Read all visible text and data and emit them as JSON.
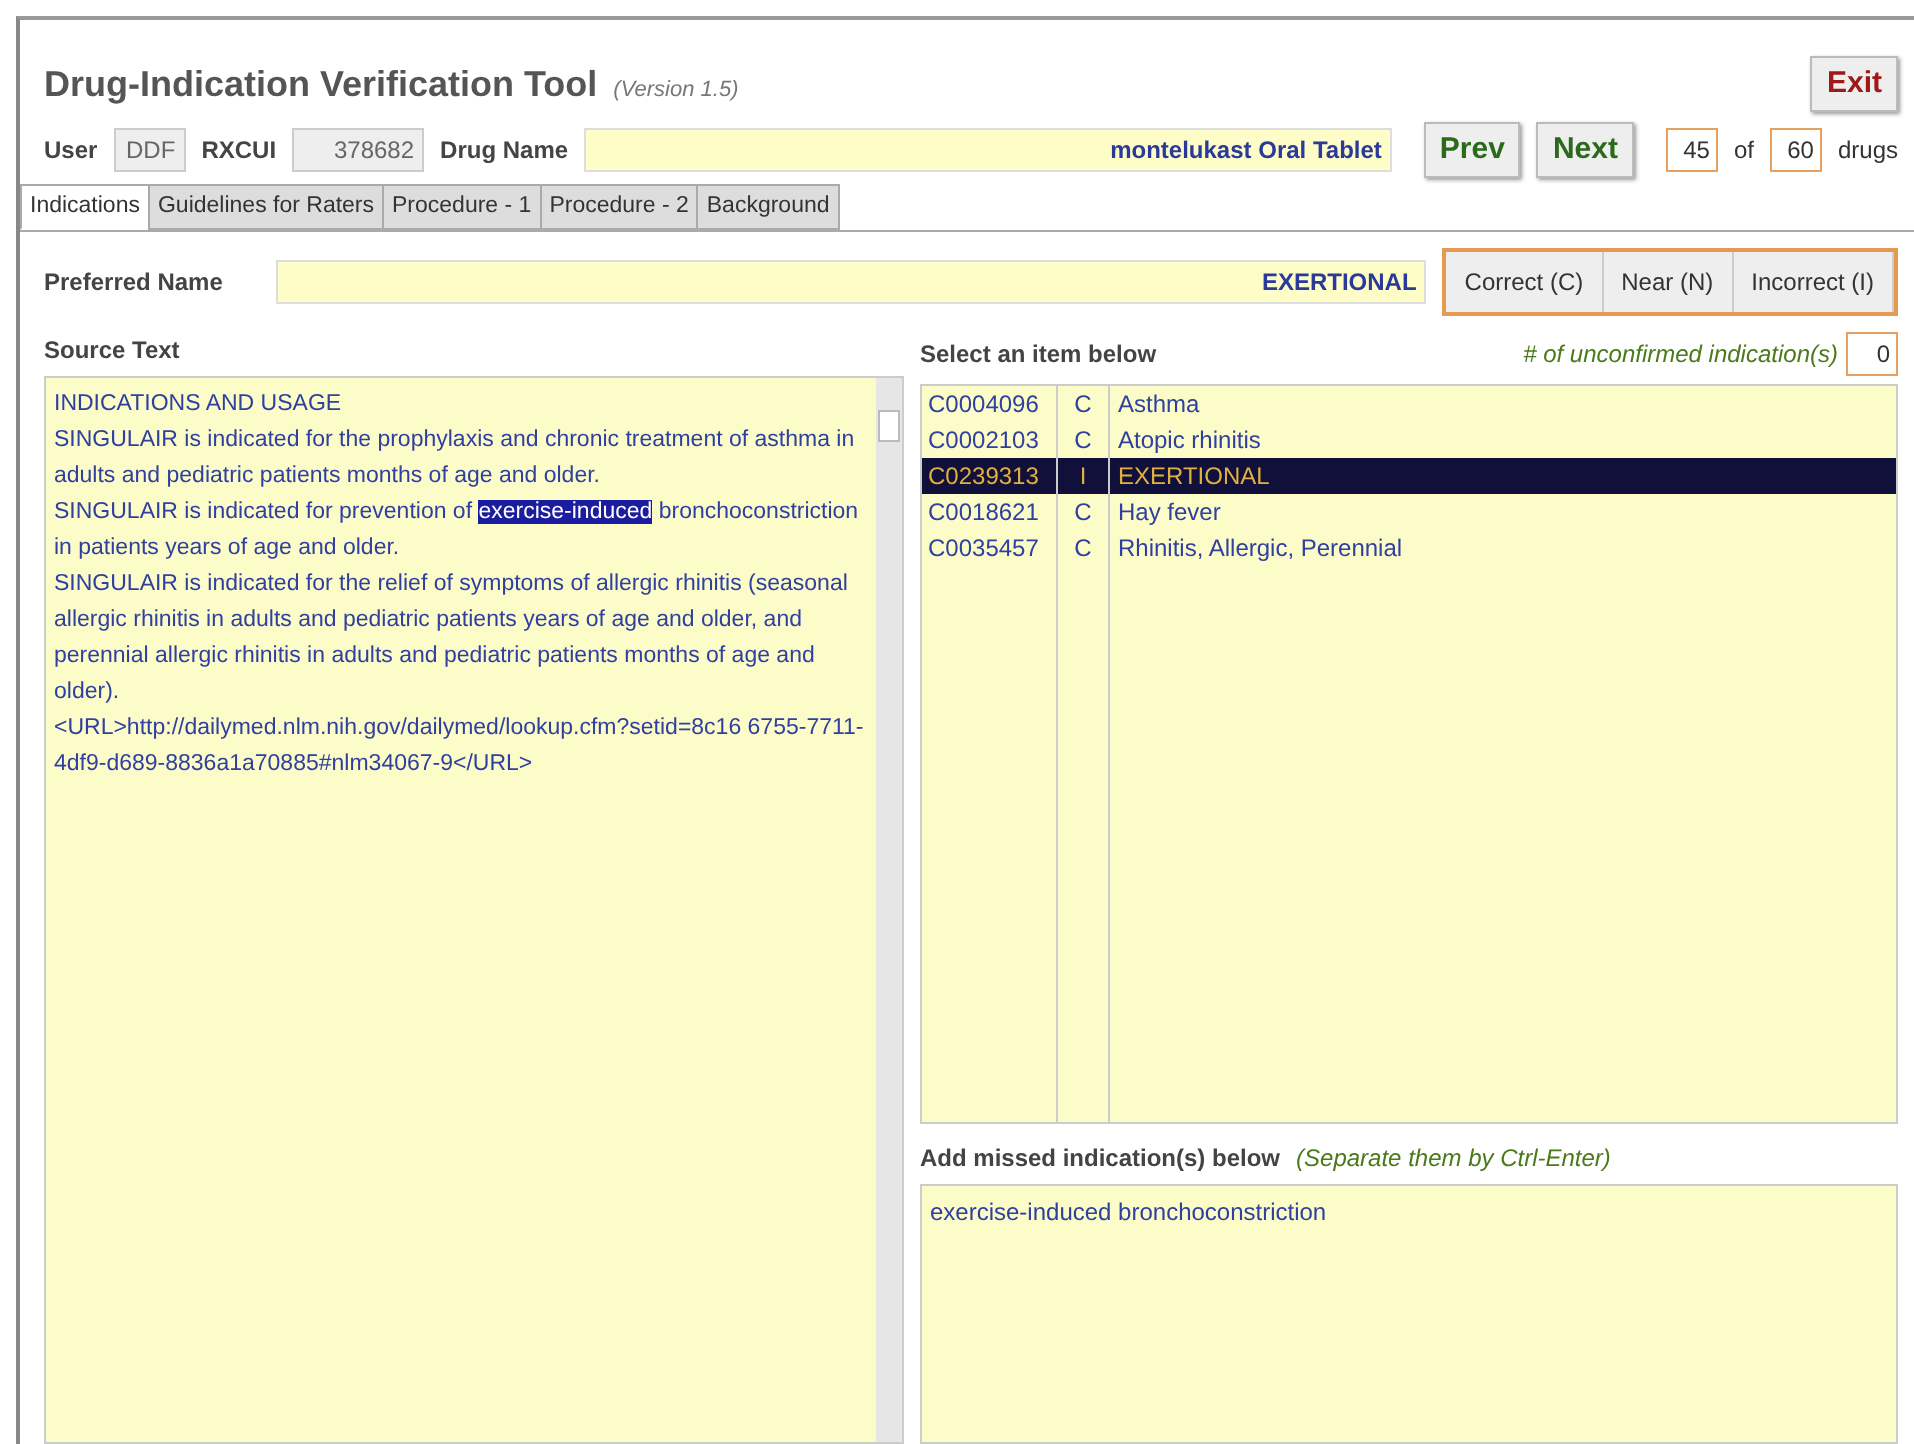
{
  "window": {
    "title": "Drug-Indication Verification Tool",
    "version": "(Version 1.5)",
    "exit_button": "Exit"
  },
  "header": {
    "user_label": "User",
    "user": "DDF",
    "rxcui_label": "RXCUI",
    "rxcui": "378682",
    "drug_name_label": "Drug Name",
    "drug_name": "montelukast Oral Tablet",
    "prev_button": "Prev",
    "next_button": "Next",
    "current": "45",
    "of_label": "of",
    "total": "60",
    "unit_label": "drugs"
  },
  "tabs": [
    {
      "label": "Indications",
      "selected": true
    },
    {
      "label": "Guidelines for Raters",
      "selected": false
    },
    {
      "label": "Procedure - 1",
      "selected": false
    },
    {
      "label": "Procedure - 2",
      "selected": false
    },
    {
      "label": "Background",
      "selected": false
    }
  ],
  "preferred": {
    "label": "Preferred Name",
    "value": "EXERTIONAL",
    "buttons": [
      "Correct (C)",
      "Near (N)",
      "Incorrect (I)"
    ]
  },
  "source": {
    "label": "Source Text",
    "paragraphs": [
      [
        {
          "text": "INDICATIONS AND USAGE",
          "highlighted": false
        }
      ],
      [
        {
          "text": "SINGULAIR is indicated for the prophylaxis and chronic treatment of asthma in adults and pediatric patients months of age and older.",
          "highlighted": false
        }
      ],
      [
        {
          "text": "SINGULAIR is indicated for prevention of ",
          "highlighted": false
        },
        {
          "text": "exercise-induced",
          "highlighted": true
        },
        {
          "text": " bronchoconstriction in patients years of age and older.",
          "highlighted": false
        }
      ],
      [
        {
          "text": "SINGULAIR is indicated for the relief of symptoms of allergic rhinitis (seasonal allergic rhinitis in adults and pediatric patients years of age and older, and perennial allergic rhinitis in adults and pediatric patients months of age and older).",
          "highlighted": false
        }
      ],
      [
        {
          "text": "<URL>http://dailymed.nlm.nih.gov/dailymed/lookup.cfm?setid=8c16 6755-7711-4df9-d689-8836a1a70885#nlm34067-9</URL>",
          "highlighted": false
        }
      ]
    ]
  },
  "items": {
    "label": "Select an item below",
    "unconfirmed_label": "# of unconfirmed indication(s)",
    "unconfirmed": "0",
    "rows": [
      {
        "code": "C0004096",
        "rating": "C",
        "name": "Asthma",
        "selected": false
      },
      {
        "code": "C0002103",
        "rating": "C",
        "name": "Atopic rhinitis",
        "selected": false
      },
      {
        "code": "C0239313",
        "rating": "I",
        "name": "EXERTIONAL",
        "selected": true
      },
      {
        "code": "C0018621",
        "rating": "C",
        "name": "Hay fever",
        "selected": false
      },
      {
        "code": "C0035457",
        "rating": "C",
        "name": "Rhinitis, Allergic, Perennial",
        "selected": false
      }
    ]
  },
  "missed": {
    "label": "Add missed indication(s) below",
    "hint": "(Separate them by Ctrl-Enter)",
    "value": "exercise-induced bronchoconstriction"
  }
}
